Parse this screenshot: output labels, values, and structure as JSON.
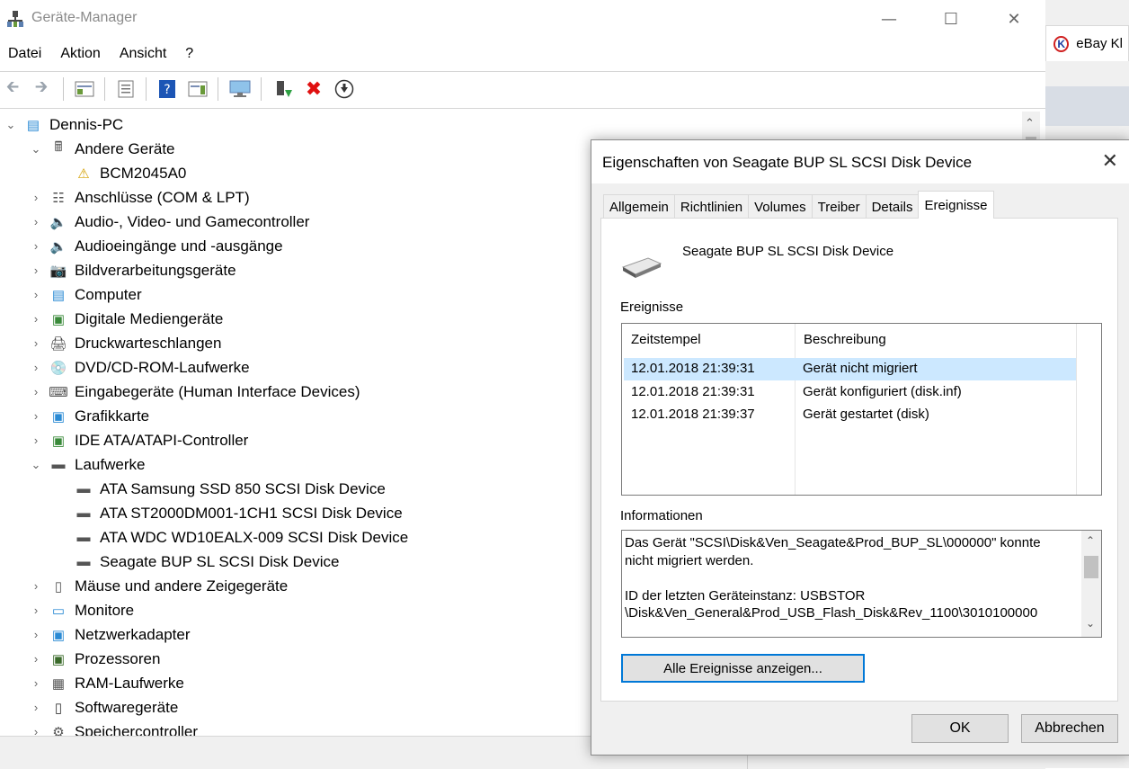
{
  "background_browser": {
    "tab_label": "eBay Kl"
  },
  "window": {
    "title": "Geräte-Manager"
  },
  "menu": [
    "Datei",
    "Aktion",
    "Ansicht",
    "?"
  ],
  "toolbar_icons": [
    "back-arrow-icon",
    "forward-arrow-icon",
    "properties-grid-icon",
    "list-view-icon",
    "help-icon",
    "details-pane-icon",
    "monitor-scan-icon",
    "update-driver-icon",
    "uninstall-x-icon",
    "download-icon"
  ],
  "tree": {
    "root": "Dennis-PC",
    "items": [
      {
        "label": "Andere Geräte",
        "expanded": true,
        "level": 1,
        "icon": "unknown-device-icon"
      },
      {
        "label": "BCM2045A0",
        "level": 2,
        "icon": "warning-device-icon"
      },
      {
        "label": "Anschlüsse (COM & LPT)",
        "level": 1,
        "icon": "port-icon"
      },
      {
        "label": "Audio-, Video- und Gamecontroller",
        "level": 1,
        "icon": "speaker-icon"
      },
      {
        "label": "Audioeingänge und -ausgänge",
        "level": 1,
        "icon": "speaker-icon"
      },
      {
        "label": "Bildverarbeitungsgeräte",
        "level": 1,
        "icon": "camera-icon"
      },
      {
        "label": "Computer",
        "level": 1,
        "icon": "computer-icon"
      },
      {
        "label": "Digitale Mediengeräte",
        "level": 1,
        "icon": "media-device-icon"
      },
      {
        "label": "Druckwarteschlangen",
        "level": 1,
        "icon": "printer-icon"
      },
      {
        "label": "DVD/CD-ROM-Laufwerke",
        "level": 1,
        "icon": "dvd-icon"
      },
      {
        "label": "Eingabegeräte (Human Interface Devices)",
        "level": 1,
        "icon": "keyboard-icon"
      },
      {
        "label": "Grafikkarte",
        "level": 1,
        "icon": "graphics-card-icon"
      },
      {
        "label": "IDE ATA/ATAPI-Controller",
        "level": 1,
        "icon": "controller-icon"
      },
      {
        "label": "Laufwerke",
        "expanded": true,
        "level": 1,
        "icon": "drive-icon"
      },
      {
        "label": "ATA Samsung SSD 850 SCSI Disk Device",
        "level": 2,
        "icon": "drive-icon"
      },
      {
        "label": "ATA ST2000DM001-1CH1 SCSI Disk Device",
        "level": 2,
        "icon": "drive-icon"
      },
      {
        "label": "ATA WDC WD10EALX-009 SCSI Disk Device",
        "level": 2,
        "icon": "drive-icon"
      },
      {
        "label": "Seagate BUP SL SCSI Disk Device",
        "level": 2,
        "icon": "drive-icon"
      },
      {
        "label": "Mäuse und andere Zeigegeräte",
        "level": 1,
        "icon": "mouse-icon"
      },
      {
        "label": "Monitore",
        "level": 1,
        "icon": "monitor-icon"
      },
      {
        "label": "Netzwerkadapter",
        "level": 1,
        "icon": "network-icon"
      },
      {
        "label": "Prozessoren",
        "level": 1,
        "icon": "processor-icon"
      },
      {
        "label": "RAM-Laufwerke",
        "level": 1,
        "icon": "ram-drive-icon"
      },
      {
        "label": "Softwaregeräte",
        "level": 1,
        "icon": "software-device-icon"
      },
      {
        "label": "Speichercontroller",
        "level": 1,
        "icon": "storage-controller-icon"
      }
    ]
  },
  "dialog": {
    "title": "Eigenschaften von Seagate BUP SL SCSI Disk Device",
    "tabs": [
      "Allgemein",
      "Richtlinien",
      "Volumes",
      "Treiber",
      "Details",
      "Ereignisse"
    ],
    "active_tab": "Ereignisse",
    "device_name": "Seagate BUP SL SCSI Disk Device",
    "events_label": "Ereignisse",
    "columns": [
      "Zeitstempel",
      "Beschreibung"
    ],
    "events": [
      {
        "time": "12.01.2018 21:39:31",
        "desc": "Gerät nicht migriert",
        "selected": true
      },
      {
        "time": "12.01.2018 21:39:31",
        "desc": "Gerät konfiguriert (disk.inf)"
      },
      {
        "time": "12.01.2018 21:39:37",
        "desc": "Gerät gestartet (disk)"
      }
    ],
    "info_label": "Informationen",
    "info_lines": [
      "Das Gerät \"SCSI\\Disk&Ven_Seagate&Prod_BUP_SL\\000000\" konnte",
      "nicht migriert werden.",
      "",
      "ID der letzten Geräteinstanz: USBSTOR",
      "\\Disk&Ven_General&Prod_USB_Flash_Disk&Rev_1100\\3010100000"
    ],
    "all_events_button": "Alle Ereignisse anzeigen...",
    "ok_button": "OK",
    "cancel_button": "Abbrechen"
  }
}
